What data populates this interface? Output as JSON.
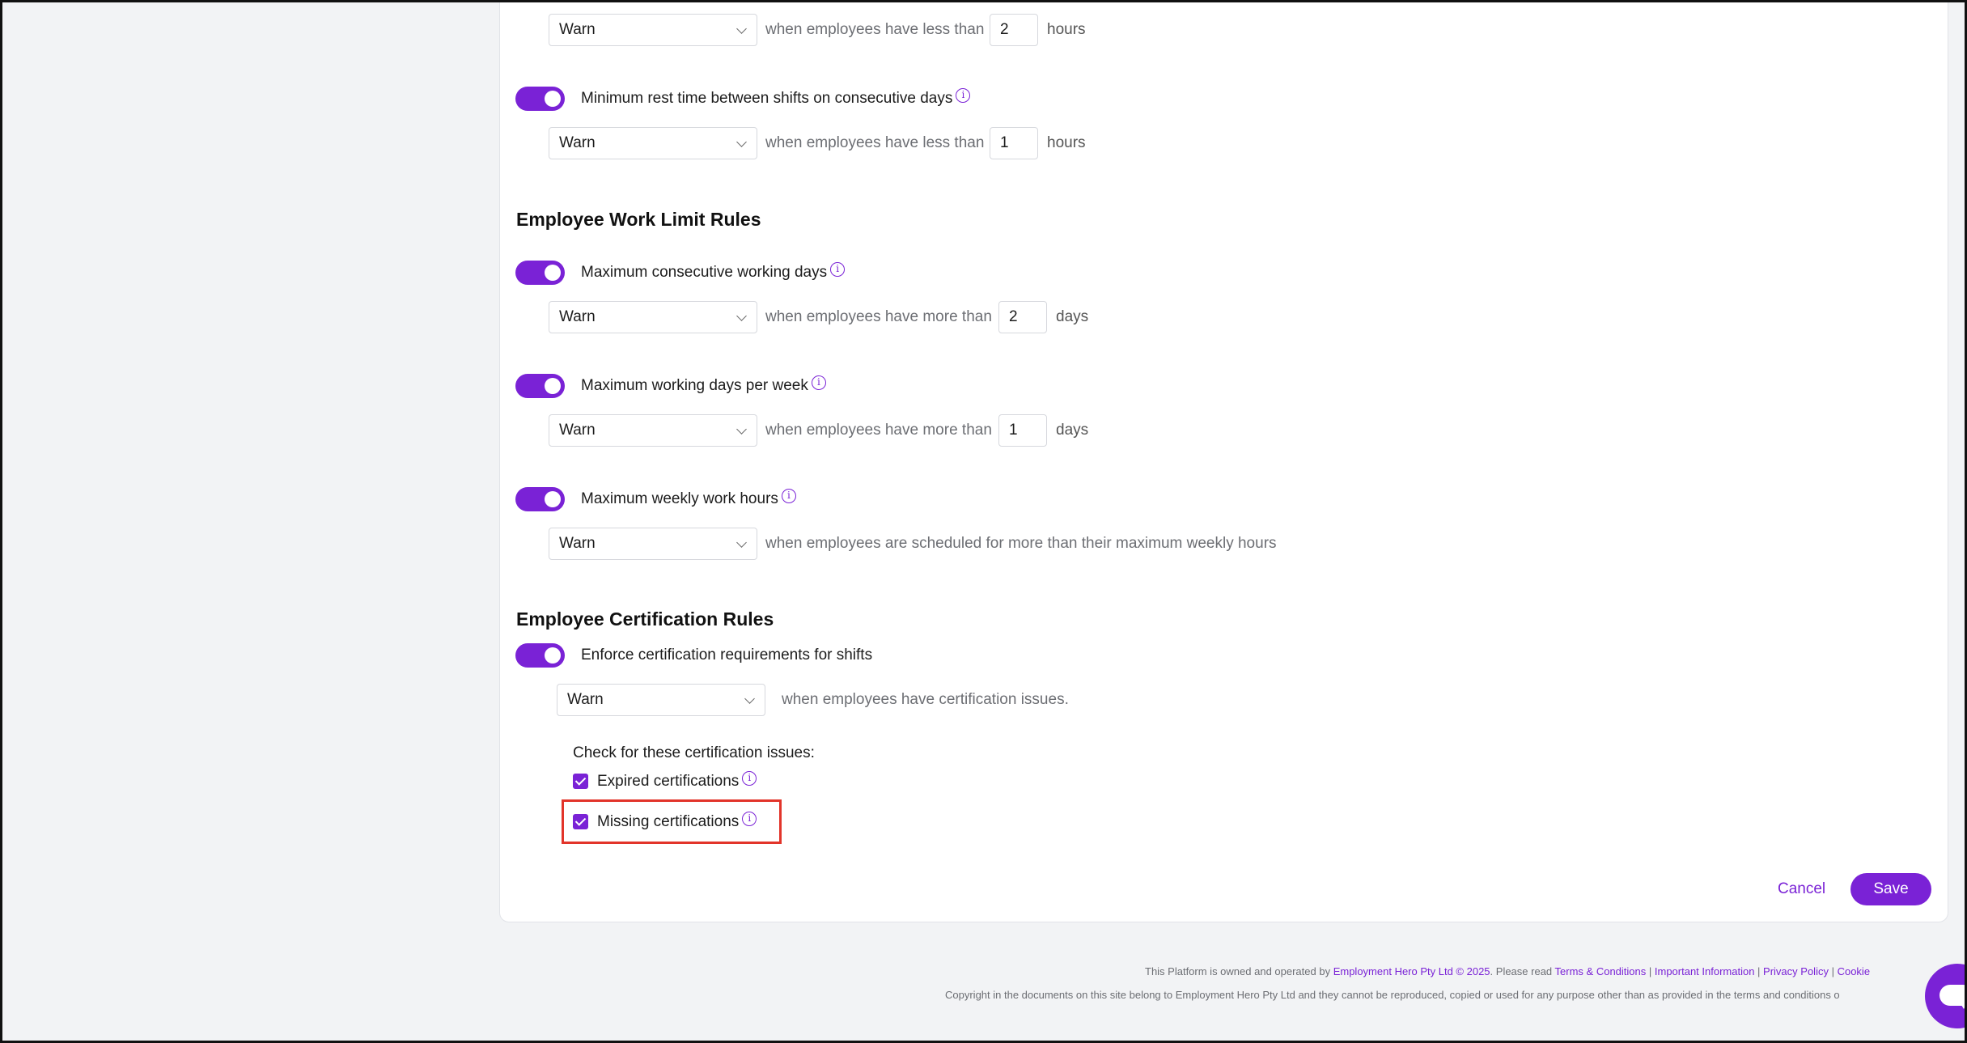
{
  "rest_rules": {
    "rule_top": {
      "action": "Warn",
      "condition": "when employees have less than",
      "value": "2",
      "unit": "hours"
    },
    "rule_consecutive": {
      "label": "Minimum rest time between shifts on consecutive days",
      "action": "Warn",
      "condition": "when employees have less than",
      "value": "1",
      "unit": "hours"
    }
  },
  "work_limit": {
    "heading": "Employee Work Limit Rules",
    "consecutive_days": {
      "label": "Maximum consecutive working days",
      "action": "Warn",
      "condition": "when employees have more than",
      "value": "2",
      "unit": "days"
    },
    "days_per_week": {
      "label": "Maximum working days per week",
      "action": "Warn",
      "condition": "when employees have more than",
      "value": "1",
      "unit": "days"
    },
    "weekly_hours": {
      "label": "Maximum weekly work hours",
      "action": "Warn",
      "condition": "when employees are scheduled for more than their maximum weekly hours"
    }
  },
  "certification": {
    "heading": "Employee Certification Rules",
    "enforce_label": "Enforce certification requirements for shifts",
    "action": "Warn",
    "condition": "when employees have certification issues.",
    "check_heading": "Check for these certification issues:",
    "expired_label": "Expired certifications",
    "missing_label": "Missing certifications"
  },
  "actions": {
    "cancel": "Cancel",
    "save": "Save"
  },
  "footer": {
    "line1_prefix": "This Platform is owned and operated by",
    "company_link": "Employment Hero Pty Ltd © 2025",
    "line1_mid": ". Please read",
    "terms": "Terms & Conditions",
    "important": "Important Information",
    "privacy": "Privacy Policy",
    "cookie": "Cookie",
    "line2": "Copyright in the documents on this site belong to Employment Hero Pty Ltd and they cannot be reproduced, copied or used for any purpose other than as provided in the terms and conditions o"
  },
  "icons": {
    "info": "info-icon",
    "chevron": "chevron-down-icon",
    "chat": "chat-icon",
    "check": "check-icon"
  },
  "colors": {
    "accent": "#7a22d6",
    "highlight": "#e2342a"
  }
}
